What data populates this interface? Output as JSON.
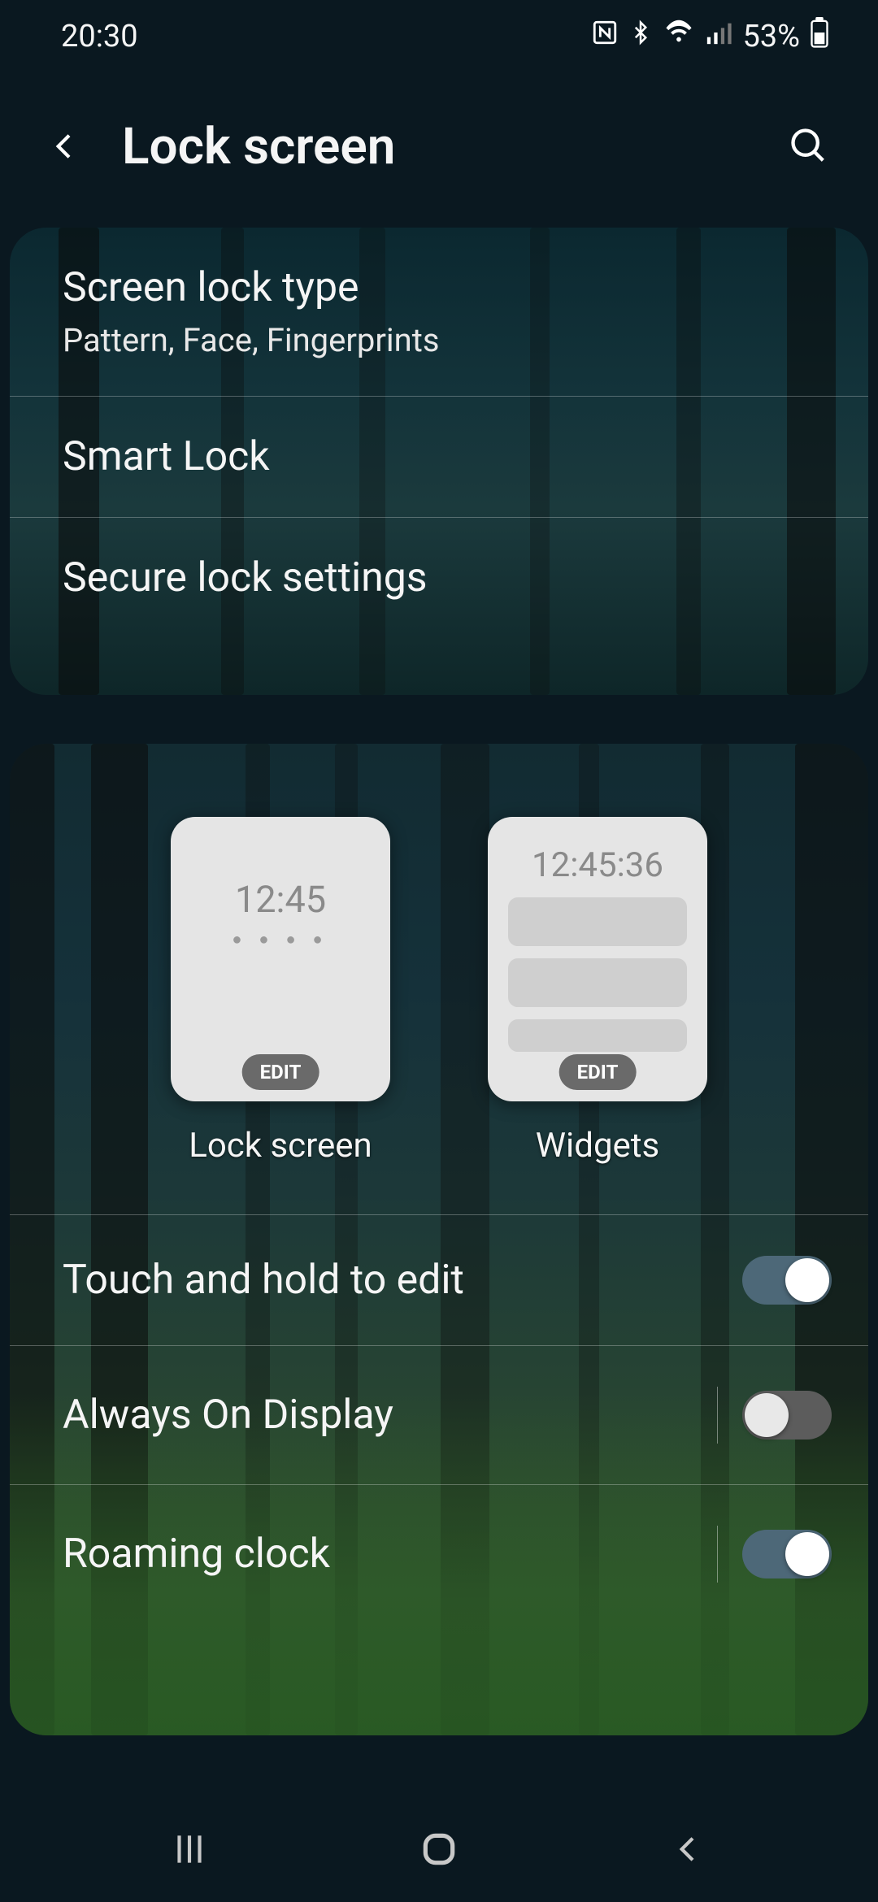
{
  "status": {
    "time": "20:30",
    "battery": "53%",
    "icons": [
      "nfc",
      "bluetooth",
      "wifi",
      "signal"
    ]
  },
  "header": {
    "title": "Lock screen"
  },
  "card1": {
    "items": [
      {
        "title": "Screen lock type",
        "sub": "Pattern, Face, Fingerprints"
      },
      {
        "title": "Smart Lock"
      },
      {
        "title": "Secure lock settings"
      }
    ]
  },
  "card2": {
    "previews": [
      {
        "time": "12:45",
        "edit": "EDIT",
        "label": "Lock screen"
      },
      {
        "time": "12:45:36",
        "edit": "EDIT",
        "label": "Widgets"
      }
    ],
    "toggles": [
      {
        "title": "Touch and hold to edit",
        "on": true,
        "sep": false
      },
      {
        "title": "Always On Display",
        "on": false,
        "sep": true
      },
      {
        "title": "Roaming clock",
        "on": true,
        "sep": true
      }
    ]
  }
}
